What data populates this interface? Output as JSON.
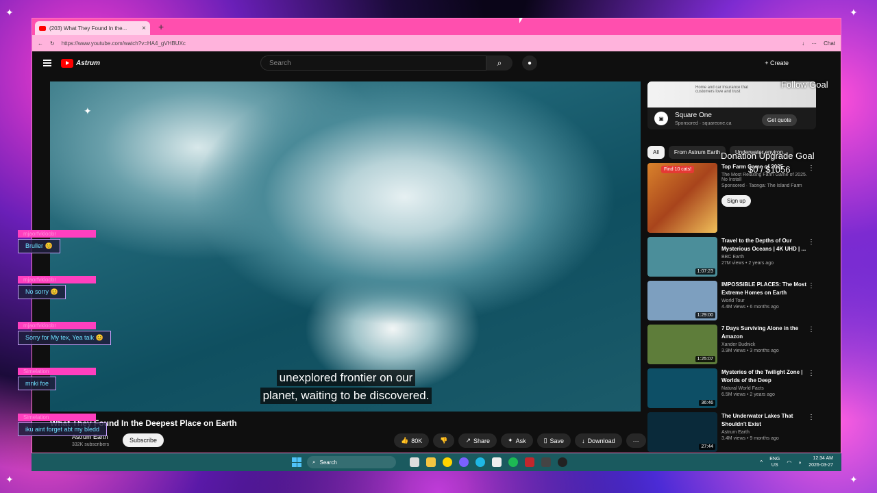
{
  "browser": {
    "tab_title": "(203) What They Found In the...",
    "tab_close": "×",
    "new_tab": "+",
    "url": "https://www.youtube.com/watch?v=HA4_gVHBUXc",
    "chat_label": "Chat"
  },
  "youtube": {
    "logo_text": "Astrum",
    "search_placeholder": "Search",
    "create_label": "+ Create"
  },
  "video": {
    "caption_line1": "unexplored frontier on our",
    "caption_line2": "planet, waiting to be discovered.",
    "title": "What They Found In the Deepest Place on Earth",
    "channel": "Astrum Earth",
    "subscribers": "332K subscribers",
    "subscribe_label": "Subscribe",
    "like_count": "80K",
    "share_label": "Share",
    "ask_label": "Ask",
    "save_label": "Save",
    "download_label": "Download",
    "more_label": "···"
  },
  "ad": {
    "banner_text": "Home and car insurance that customers love and trust",
    "logo": "▣",
    "name": "Square One",
    "sponsored": "Sponsored · squareone.ca",
    "cta": "Get quote"
  },
  "chips": [
    "All",
    "From Astrum Earth",
    "Underwater environ..."
  ],
  "farm_ad": {
    "badge": "Find 10 cats!",
    "title": "Top Farm Game of 2025",
    "desc": "The Most Relaxing Farm Game of 2025. No Install",
    "sponsored": "Sponsored · Taonga: The Island Farm",
    "cta": "Sign up"
  },
  "recommendations": [
    {
      "title": "Travel to the Depths of Our Mysterious Oceans | 4K UHD | ...",
      "channel": "BBC Earth",
      "stats": "27M views • 2 years ago",
      "duration": "1:07:23",
      "color": "#4b8e9a"
    },
    {
      "title": "IMPOSSIBLE PLACES: The Most Extreme Homes on Earth",
      "channel": "World Tour",
      "stats": "4.4M views • 6 months ago",
      "duration": "1:29:00",
      "color": "#7d9fbf"
    },
    {
      "title": "7 Days Surviving Alone in the Amazon",
      "channel": "Xander Budnick",
      "stats": "3.9M views • 3 months ago",
      "duration": "1:25:07",
      "color": "#5e7d3a"
    },
    {
      "title": "Mysteries of the Twilight Zone | Worlds of the Deep",
      "channel": "Natural World Facts",
      "stats": "6.5M views • 2 years ago",
      "duration": "36:46",
      "color": "#0d4f66"
    },
    {
      "title": "The Underwater Lakes That Shouldn't Exist",
      "channel": "Astrum Earth",
      "stats": "3.4M views • 9 months ago",
      "duration": "27:44",
      "color": "#0a2a3a"
    }
  ],
  "overlay": {
    "goal1": "Follow Goal",
    "goal2": "Donation Upgrade Goal",
    "goal2_amount": "$0 / $1056",
    "chat": [
      {
        "user": "mjaorfvkloobr",
        "msg": "Bruller 😊"
      },
      {
        "user": "mjaorfvkloobr",
        "msg": "No sorry 😊"
      },
      {
        "user": "mjaorfvkloobr",
        "msg": "Sorry for My tex, Yea talk 😊"
      },
      {
        "user": "Simelation",
        "msg": "mnki foe"
      },
      {
        "user": "Simelation",
        "msg": "iku aint forget abt my bledd"
      }
    ]
  },
  "taskbar": {
    "search": "Search",
    "lang1": "ENG",
    "lang2": "US",
    "time": "12:34 AM",
    "date": "2026-03-27"
  }
}
